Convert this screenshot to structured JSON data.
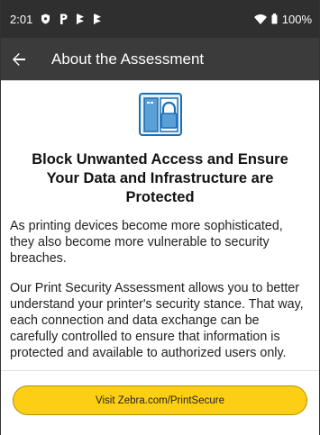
{
  "status_bar": {
    "time": "2:01",
    "battery": "100%",
    "icons": [
      "shield-icon",
      "notification-p-icon",
      "flag-icon",
      "flag-icon",
      "wifi-icon",
      "battery-icon"
    ]
  },
  "app_bar": {
    "back_icon": "back-arrow-icon",
    "title": "About the Assessment"
  },
  "main": {
    "hero_icon": "door-lock-icon",
    "heading": "Block Unwanted Access and Ensure Your Data and Infrastructure are Protected",
    "paragraphs": [
      "As printing devices become more sophisticated, they also become more vulnerable to security breaches.",
      "Our Print Security Assessment allows you to better understand your printer's security stance. That way, each connection and data exchange can be carefully controlled to ensure that information is protected and available to authorized users only."
    ]
  },
  "footer": {
    "button_label": "Visit Zebra.com/PrintSecure"
  },
  "colors": {
    "status_bar": "#2f2f2f",
    "app_bar": "#3b3b3b",
    "accent_button": "#fccf15",
    "icon_blue": "#1a6fb4"
  }
}
